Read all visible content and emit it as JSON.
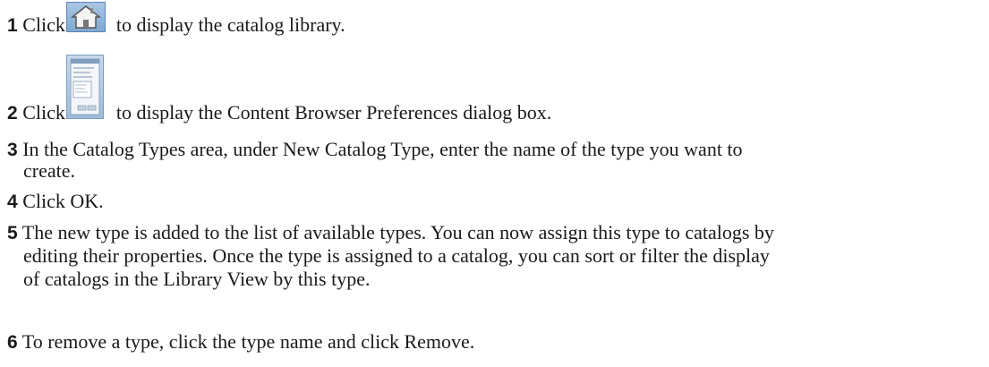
{
  "steps": [
    {
      "num": "1",
      "before": "Click",
      "after": "to display the catalog library.",
      "icon": "home-icon"
    },
    {
      "num": "2",
      "before": "Click",
      "after": "to display the Content Browser Preferences dialog box.",
      "icon": "preferences-dialog-icon"
    },
    {
      "num": "3",
      "line1": "In the Catalog Types area, under New Catalog Type, enter the name of the type you want to",
      "line2": "create."
    },
    {
      "num": "4",
      "text": "Click OK."
    },
    {
      "num": "5",
      "line1": "The new type is added to the list of available types. You can now assign this type to catalogs by",
      "line2": "editing their properties. Once the type is assigned to a catalog, you can sort or filter the display",
      "line3": "of catalogs in the Library View by this type."
    },
    {
      "num": "6",
      "text": "To remove a type, click the type name and click Remove."
    }
  ]
}
